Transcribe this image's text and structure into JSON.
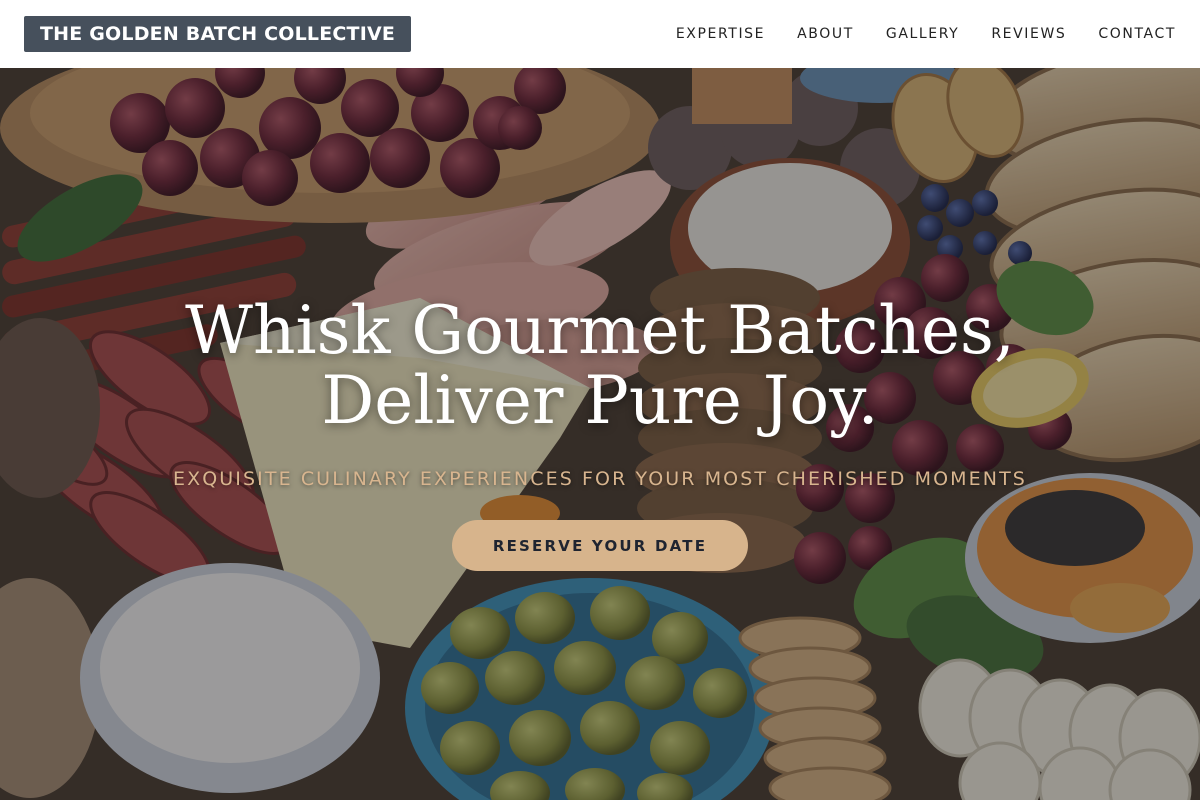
{
  "brand": {
    "name": "THE GOLDEN BATCH COLLECTIVE"
  },
  "nav": {
    "items": [
      {
        "label": "EXPERTISE"
      },
      {
        "label": "ABOUT"
      },
      {
        "label": "GALLERY"
      },
      {
        "label": "REVIEWS"
      },
      {
        "label": "CONTACT"
      }
    ]
  },
  "hero": {
    "title_line1": "Whisk Gourmet Batches,",
    "title_line2": "Deliver Pure Joy.",
    "subtitle": "EXQUISITE CULINARY EXPERIENCES FOR YOUR MOST CHERISHED MOMENTS",
    "cta_label": "RESERVE YOUR DATE",
    "background": "charcuterie-grazing-board-photo"
  },
  "colors": {
    "header_bg": "#ffffff",
    "brand_bg": "#46505c",
    "accent": "#d7b48c",
    "subtitle_text": "#d8b58f",
    "cta_text": "#1f2430"
  }
}
